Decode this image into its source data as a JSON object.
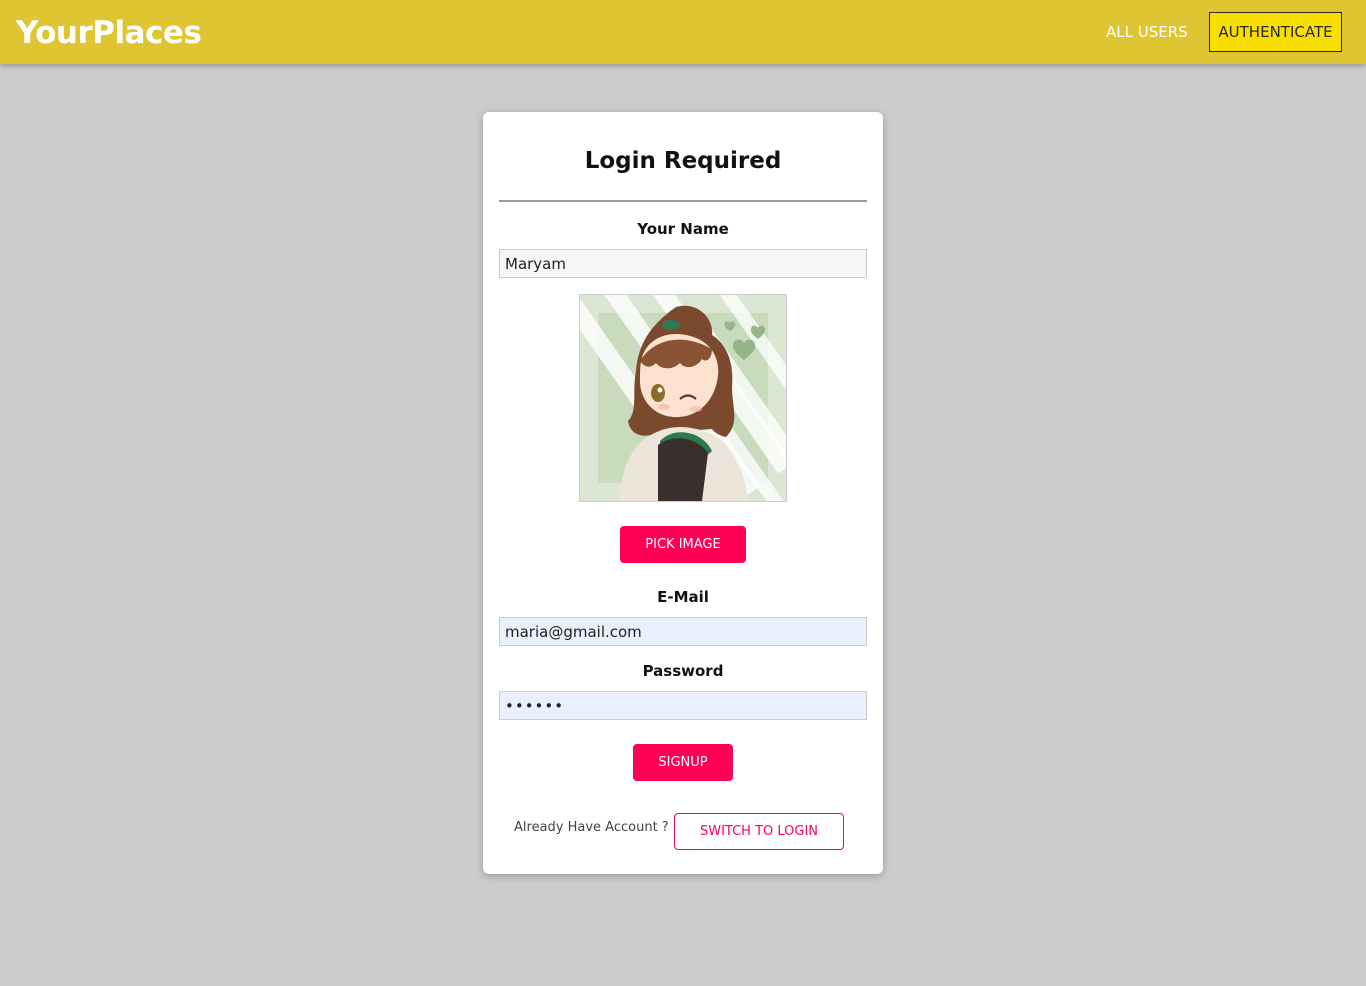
{
  "app": {
    "title": "YourPlaces"
  },
  "nav": {
    "all_users": "ALL USERS",
    "authenticate": "AUTHENTICATE"
  },
  "card": {
    "title": "Login Required"
  },
  "form": {
    "name_label": "Your Name",
    "name_value": "Maryam",
    "email_label": "E-Mail",
    "email_value": "maria@gmail.com",
    "password_label": "Password",
    "password_value": "••••••"
  },
  "buttons": {
    "pick_image": "PICK IMAGE",
    "signup": "SIGNUP",
    "switch_to_login": "SWITCH TO LOGIN"
  },
  "footer": {
    "already_have_account": "Already Have Account ?"
  },
  "colors": {
    "header": "#dec531",
    "accent": "#ff0055",
    "page_bg": "#cccccc",
    "auth_active": "#f8df00"
  }
}
